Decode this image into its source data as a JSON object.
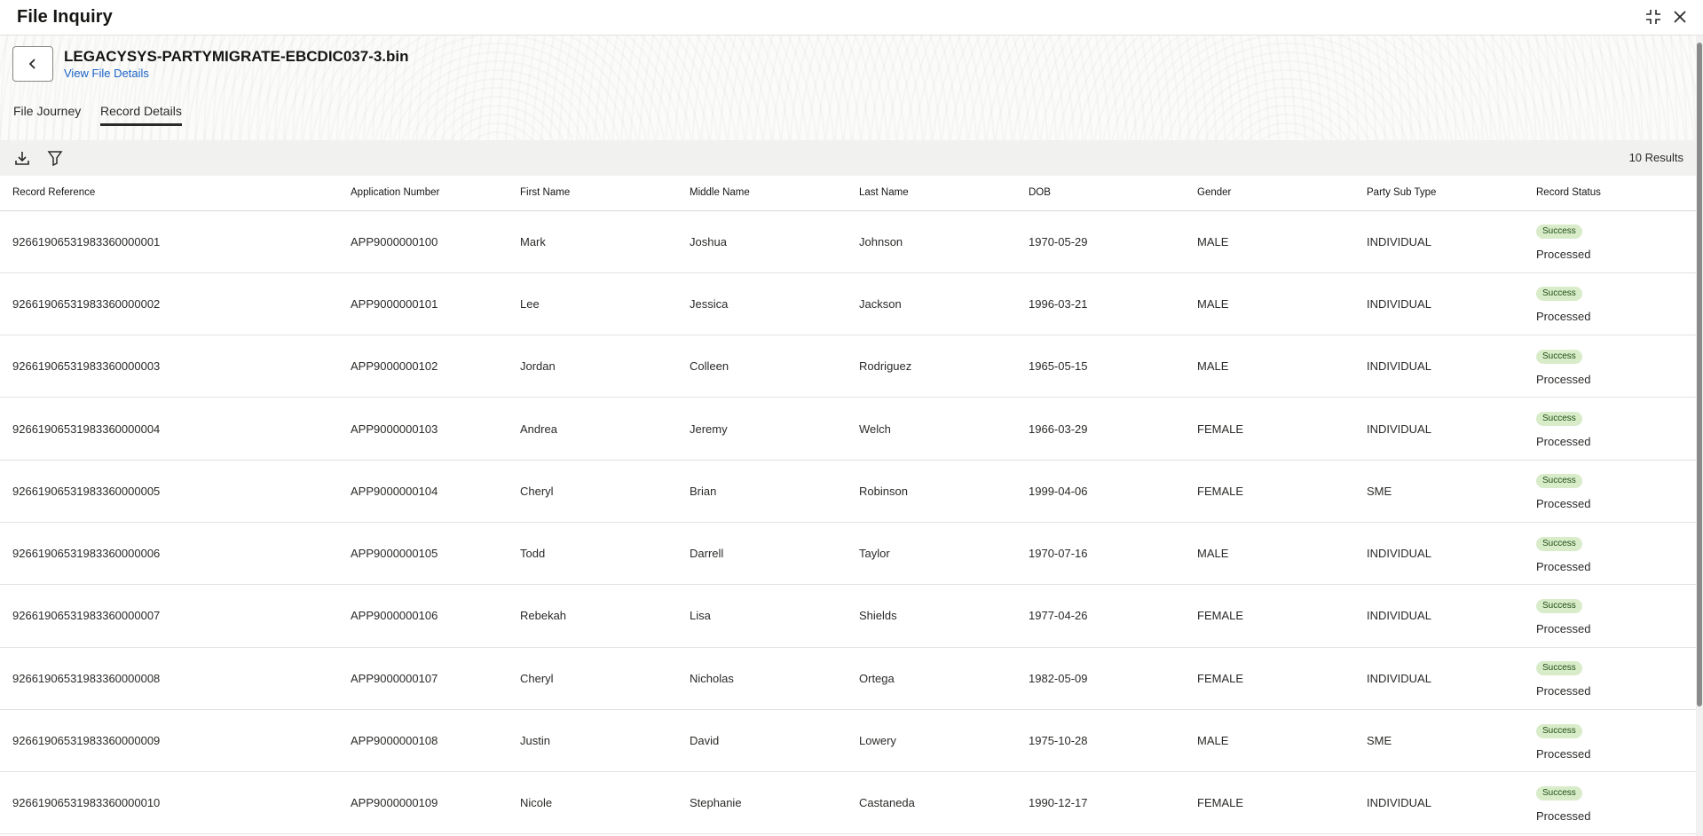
{
  "window": {
    "title": "File Inquiry",
    "icons": {
      "minimize": "compress-icon",
      "close": "close-icon"
    }
  },
  "file": {
    "name": "LEGACYSYS-PARTYMIGRATE-EBCDIC037-3.bin",
    "view_details_label": "View File Details"
  },
  "tabs": [
    {
      "label": "File Journey",
      "active": false
    },
    {
      "label": "Record Details",
      "active": true
    }
  ],
  "toolbar": {
    "download_icon": "download-icon",
    "filter_icon": "filter-icon",
    "results_label": "10 Results"
  },
  "table": {
    "columns": [
      "Record Reference",
      "Application Number",
      "First Name",
      "Middle Name",
      "Last Name",
      "DOB",
      "Gender",
      "Party Sub Type",
      "Record Status"
    ],
    "rows": [
      {
        "ref": "92661906531983360000001",
        "app": "APP9000000100",
        "first": "Mark",
        "middle": "Joshua",
        "last": "Johnson",
        "dob": "1970-05-29",
        "gender": "MALE",
        "subtype": "INDIVIDUAL",
        "badge": "Success",
        "status": "Processed"
      },
      {
        "ref": "92661906531983360000002",
        "app": "APP9000000101",
        "first": "Lee",
        "middle": "Jessica",
        "last": "Jackson",
        "dob": "1996-03-21",
        "gender": "MALE",
        "subtype": "INDIVIDUAL",
        "badge": "Success",
        "status": "Processed"
      },
      {
        "ref": "92661906531983360000003",
        "app": "APP9000000102",
        "first": "Jordan",
        "middle": "Colleen",
        "last": "Rodriguez",
        "dob": "1965-05-15",
        "gender": "MALE",
        "subtype": "INDIVIDUAL",
        "badge": "Success",
        "status": "Processed"
      },
      {
        "ref": "92661906531983360000004",
        "app": "APP9000000103",
        "first": "Andrea",
        "middle": "Jeremy",
        "last": "Welch",
        "dob": "1966-03-29",
        "gender": "FEMALE",
        "subtype": "INDIVIDUAL",
        "badge": "Success",
        "status": "Processed"
      },
      {
        "ref": "92661906531983360000005",
        "app": "APP9000000104",
        "first": "Cheryl",
        "middle": "Brian",
        "last": "Robinson",
        "dob": "1999-04-06",
        "gender": "FEMALE",
        "subtype": "SME",
        "badge": "Success",
        "status": "Processed"
      },
      {
        "ref": "92661906531983360000006",
        "app": "APP9000000105",
        "first": "Todd",
        "middle": "Darrell",
        "last": "Taylor",
        "dob": "1970-07-16",
        "gender": "MALE",
        "subtype": "INDIVIDUAL",
        "badge": "Success",
        "status": "Processed"
      },
      {
        "ref": "92661906531983360000007",
        "app": "APP9000000106",
        "first": "Rebekah",
        "middle": "Lisa",
        "last": "Shields",
        "dob": "1977-04-26",
        "gender": "FEMALE",
        "subtype": "INDIVIDUAL",
        "badge": "Success",
        "status": "Processed"
      },
      {
        "ref": "92661906531983360000008",
        "app": "APP9000000107",
        "first": "Cheryl",
        "middle": "Nicholas",
        "last": "Ortega",
        "dob": "1982-05-09",
        "gender": "FEMALE",
        "subtype": "INDIVIDUAL",
        "badge": "Success",
        "status": "Processed"
      },
      {
        "ref": "92661906531983360000009",
        "app": "APP9000000108",
        "first": "Justin",
        "middle": "David",
        "last": "Lowery",
        "dob": "1975-10-28",
        "gender": "MALE",
        "subtype": "SME",
        "badge": "Success",
        "status": "Processed"
      },
      {
        "ref": "92661906531983360000010",
        "app": "APP9000000109",
        "first": "Nicole",
        "middle": "Stephanie",
        "last": "Castaneda",
        "dob": "1990-12-17",
        "gender": "FEMALE",
        "subtype": "INDIVIDUAL",
        "badge": "Success",
        "status": "Processed"
      }
    ]
  },
  "colors": {
    "success_badge_bg": "#d9ecca",
    "success_badge_text": "#1e4d12",
    "link": "#1a63c7"
  }
}
